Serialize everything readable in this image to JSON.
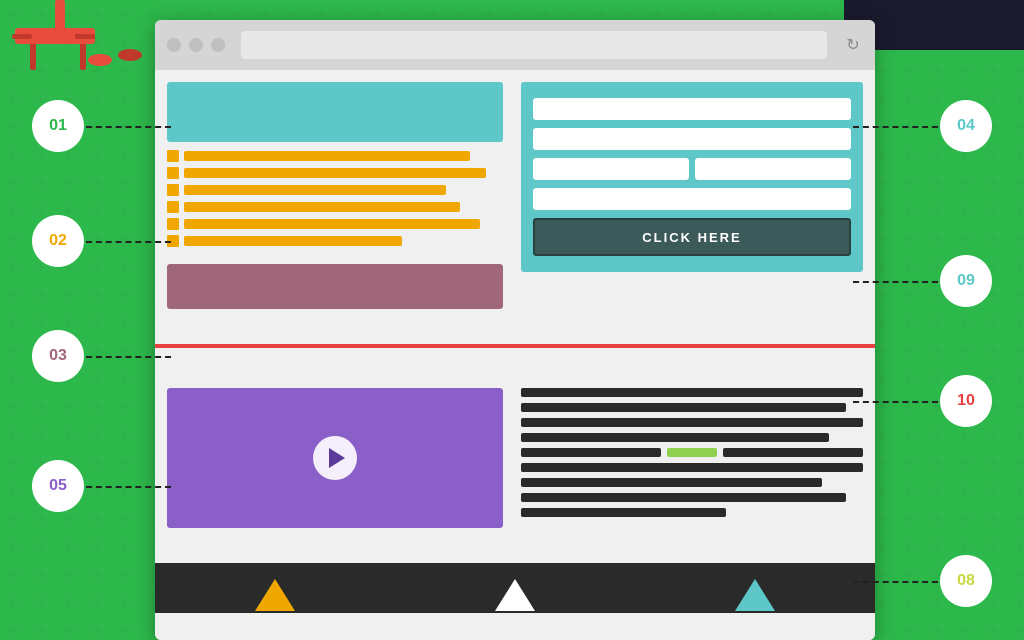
{
  "background": {
    "color": "#2db84b"
  },
  "browser": {
    "toolbar": {
      "dots": [
        "dot1",
        "dot2",
        "dot3"
      ],
      "refresh_icon": "↻"
    },
    "sections": {
      "teal_banner": "header banner",
      "yellow_list_label": "list section",
      "mauve_banner_label": "content banner",
      "form_area_label": "form section",
      "click_here_button": "CLICK HERE",
      "video_section_label": "video section",
      "text_content_label": "text content"
    },
    "footer_shapes": [
      "triangle1",
      "triangle2"
    ]
  },
  "labels": {
    "circle_01": "01",
    "circle_02": "02",
    "circle_03": "03",
    "circle_04": "04",
    "circle_05": "05",
    "circle_08": "08",
    "circle_09": "09",
    "circle_10": "10"
  },
  "colors": {
    "green": "#2db84b",
    "teal": "#5ec8c8",
    "yellow": "#f0a800",
    "mauve": "#a0677a",
    "purple": "#8b5fc8",
    "dark": "#2a2a2a",
    "red": "#e84040",
    "lime": "#c8d840",
    "coral": "#e84040"
  }
}
